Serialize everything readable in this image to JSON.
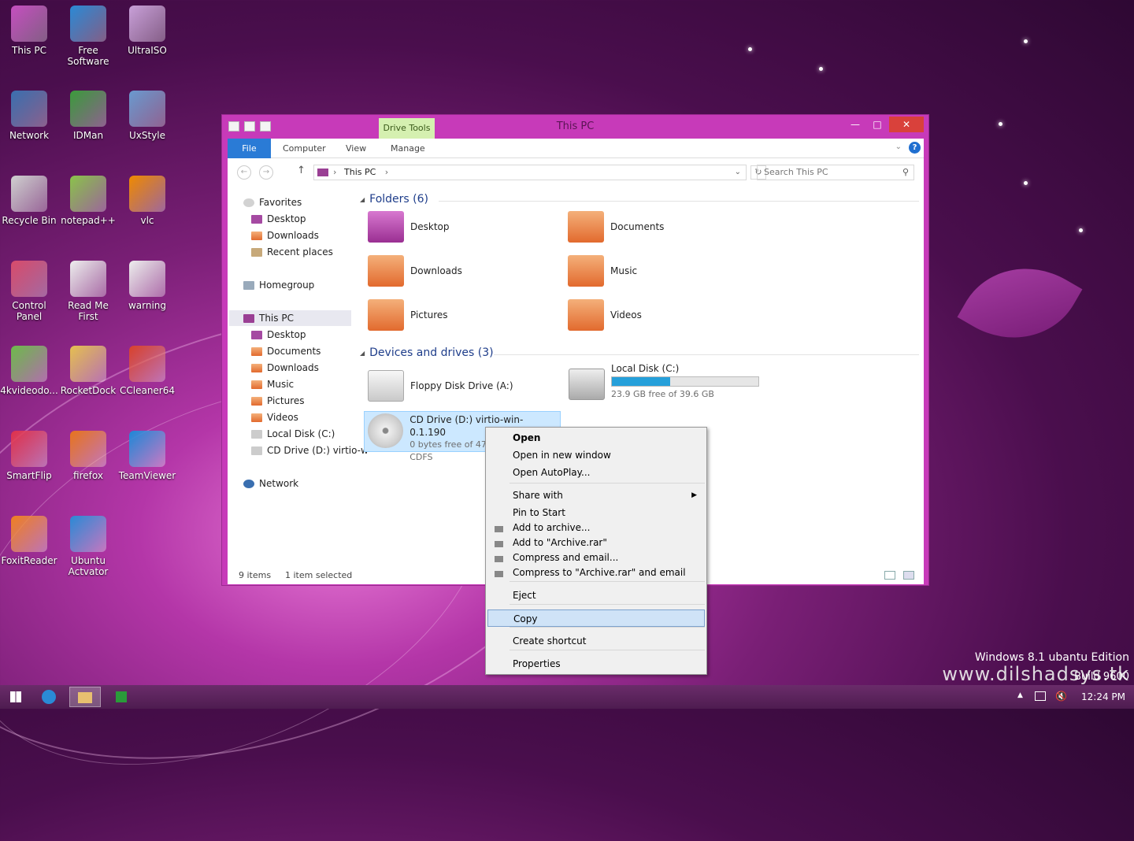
{
  "desktop": {
    "icons": [
      {
        "label": "This PC",
        "icon": "monitor-icon",
        "color": "#c64fc0"
      },
      {
        "label": "Free Software",
        "icon": "ie-icon",
        "color": "#2a8ad6"
      },
      {
        "label": "UltraISO",
        "icon": "disc-icon",
        "color": "#c9a0d9"
      },
      {
        "label": "Network",
        "icon": "globe-icon",
        "color": "#3a6fb0"
      },
      {
        "label": "IDMan",
        "icon": "idm-icon",
        "color": "#3b9b3b"
      },
      {
        "label": "UxStyle",
        "icon": "uxstyle-icon",
        "color": "#6a9ad0"
      },
      {
        "label": "Recycle Bin",
        "icon": "recycle-bin-icon",
        "color": "#d0d0d0"
      },
      {
        "label": "notepad++",
        "icon": "notepad-plus-icon",
        "color": "#8bc34a"
      },
      {
        "label": "vlc",
        "icon": "vlc-icon",
        "color": "#f08a00"
      },
      {
        "label": "Control Panel",
        "icon": "control-panel-icon",
        "color": "#d94b6b"
      },
      {
        "label": "Read Me First",
        "icon": "document-icon",
        "color": "#eeeeee"
      },
      {
        "label": "warning",
        "icon": "document-icon",
        "color": "#eeeeee"
      },
      {
        "label": "4kvideodo...",
        "icon": "4kvideo-icon",
        "color": "#6dbb4a"
      },
      {
        "label": "RocketDock",
        "icon": "rocketdock-icon",
        "color": "#e6c050"
      },
      {
        "label": "CCleaner64",
        "icon": "ccleaner-icon",
        "color": "#d9412b"
      },
      {
        "label": "SmartFlip",
        "icon": "smartflip-icon",
        "color": "#e0304a"
      },
      {
        "label": "firefox",
        "icon": "firefox-icon",
        "color": "#e8741c"
      },
      {
        "label": "TeamViewer",
        "icon": "teamviewer-icon",
        "color": "#1e88d8"
      },
      {
        "label": "FoxitReader",
        "icon": "pdf-icon",
        "color": "#f08020"
      },
      {
        "label": "Ubuntu Actvator",
        "icon": "ie-icon",
        "color": "#2a8ad6"
      }
    ],
    "watermark_line1": "Windows 8.1 ubantu Edition",
    "watermark_line2": "www.dilshadsys.tk",
    "watermark_build": "Build 9600"
  },
  "window": {
    "title": "This PC",
    "drive_tools": "Drive Tools",
    "tabs": [
      "File",
      "Computer",
      "View",
      "Manage"
    ],
    "address": "This PC",
    "search_placeholder": "Search This PC",
    "nav": {
      "favorites": "Favorites",
      "fav_items": [
        "Desktop",
        "Downloads",
        "Recent places"
      ],
      "homegroup": "Homegroup",
      "thispc": "This PC",
      "pc_items": [
        "Desktop",
        "Documents",
        "Downloads",
        "Music",
        "Pictures",
        "Videos",
        "Local Disk (C:)",
        "CD Drive (D:) virtio-w"
      ],
      "network": "Network"
    },
    "folders_header": "Folders (6)",
    "folders": [
      "Desktop",
      "Documents",
      "Downloads",
      "Music",
      "Pictures",
      "Videos"
    ],
    "drives_header": "Devices and drives (3)",
    "drives": {
      "floppy": "Floppy Disk Drive (A:)",
      "local_name": "Local Disk (C:)",
      "local_free": "23.9 GB free of 39.6 GB",
      "local_used_fraction": 0.4,
      "cd_name": "CD Drive (D:) virtio-win-0.1.190",
      "cd_free": "0 bytes free of 478",
      "cd_fs": "CDFS"
    },
    "status_items": "9 items",
    "status_selected": "1 item selected"
  },
  "context_menu": {
    "items": [
      "Open",
      "Open in new window",
      "Open AutoPlay...",
      "Share with",
      "Pin to Start",
      "Add to archive...",
      "Add to \"Archive.rar\"",
      "Compress and email...",
      "Compress to \"Archive.rar\" and email",
      "Eject",
      "Copy",
      "Create shortcut",
      "Properties"
    ]
  },
  "taskbar": {
    "clock": "12:24 PM"
  }
}
